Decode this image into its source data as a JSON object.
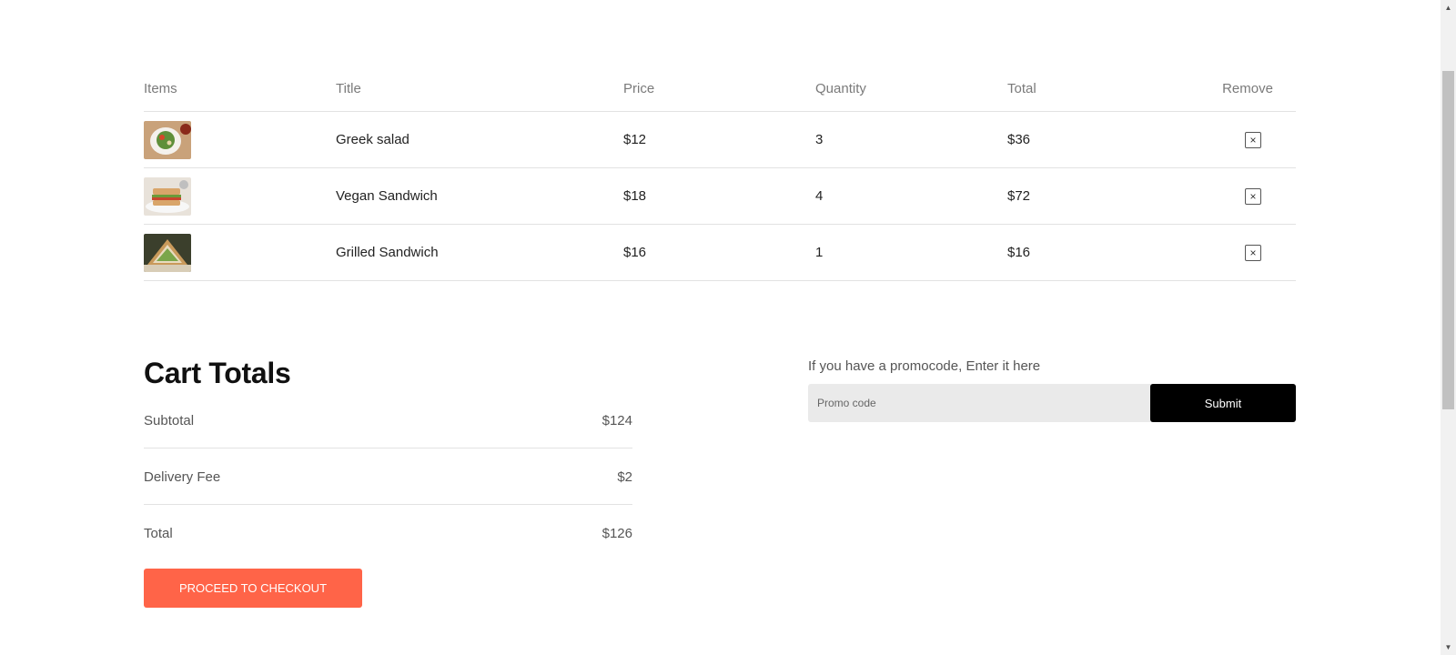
{
  "cart": {
    "headers": {
      "items": "Items",
      "title": "Title",
      "price": "Price",
      "quantity": "Quantity",
      "total": "Total",
      "remove": "Remove"
    },
    "rows": [
      {
        "title": "Greek salad",
        "price": "$12",
        "quantity": "3",
        "total": "$36",
        "image": "greek-salad-photo",
        "remove": "×"
      },
      {
        "title": "Vegan Sandwich",
        "price": "$18",
        "quantity": "4",
        "total": "$72",
        "image": "vegan-sandwich-photo",
        "remove": "×"
      },
      {
        "title": "Grilled Sandwich",
        "price": "$16",
        "quantity": "1",
        "total": "$16",
        "image": "grilled-sandwich-photo",
        "remove": "×"
      }
    ]
  },
  "totals": {
    "heading": "Cart Totals",
    "subtotal_label": "Subtotal",
    "subtotal_value": "$124",
    "delivery_label": "Delivery Fee",
    "delivery_value": "$2",
    "total_label": "Total",
    "total_value": "$126",
    "checkout_label": "PROCEED TO CHECKOUT"
  },
  "promo": {
    "label": "If you have a promocode, Enter it here",
    "placeholder": "Promo code",
    "submit_label": "Submit"
  },
  "scrollbar": {
    "up": "▲",
    "down": "▼"
  },
  "colors": {
    "accent": "#ff6448",
    "submit_bg": "#000000",
    "promo_bg": "#eaeaea"
  }
}
